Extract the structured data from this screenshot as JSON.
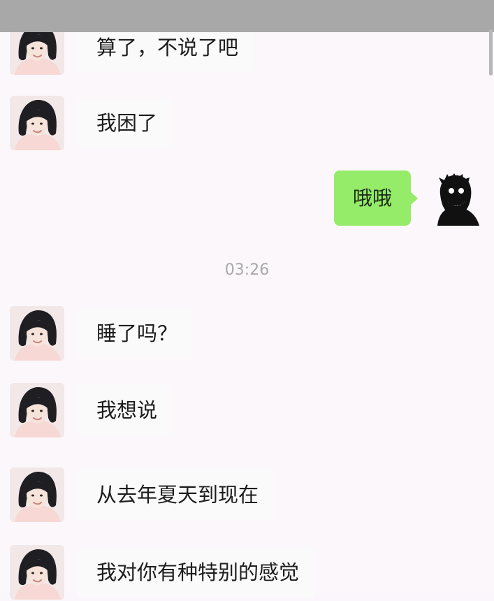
{
  "conversation": {
    "messages": [
      {
        "sender": "contact",
        "text": "算了，不说了吧"
      },
      {
        "sender": "contact",
        "text": "我困了"
      },
      {
        "sender": "self",
        "text": "哦哦"
      },
      {
        "sender": "contact",
        "text": "睡了吗？"
      },
      {
        "sender": "contact",
        "text": "我想说"
      },
      {
        "sender": "contact",
        "text": "从去年夏天到现在"
      },
      {
        "sender": "contact",
        "text": "我对你有种特别的感觉"
      }
    ],
    "timestamp": "03:26"
  },
  "colors": {
    "background": "#fbf7fb",
    "incoming_bubble": "#fbfafb",
    "outgoing_bubble": "#95ec69",
    "timestamp_text": "#a9a9a9"
  },
  "icons": {
    "contact_avatar": "woman-photo-avatar",
    "self_avatar": "dark-smiling-face-avatar"
  }
}
